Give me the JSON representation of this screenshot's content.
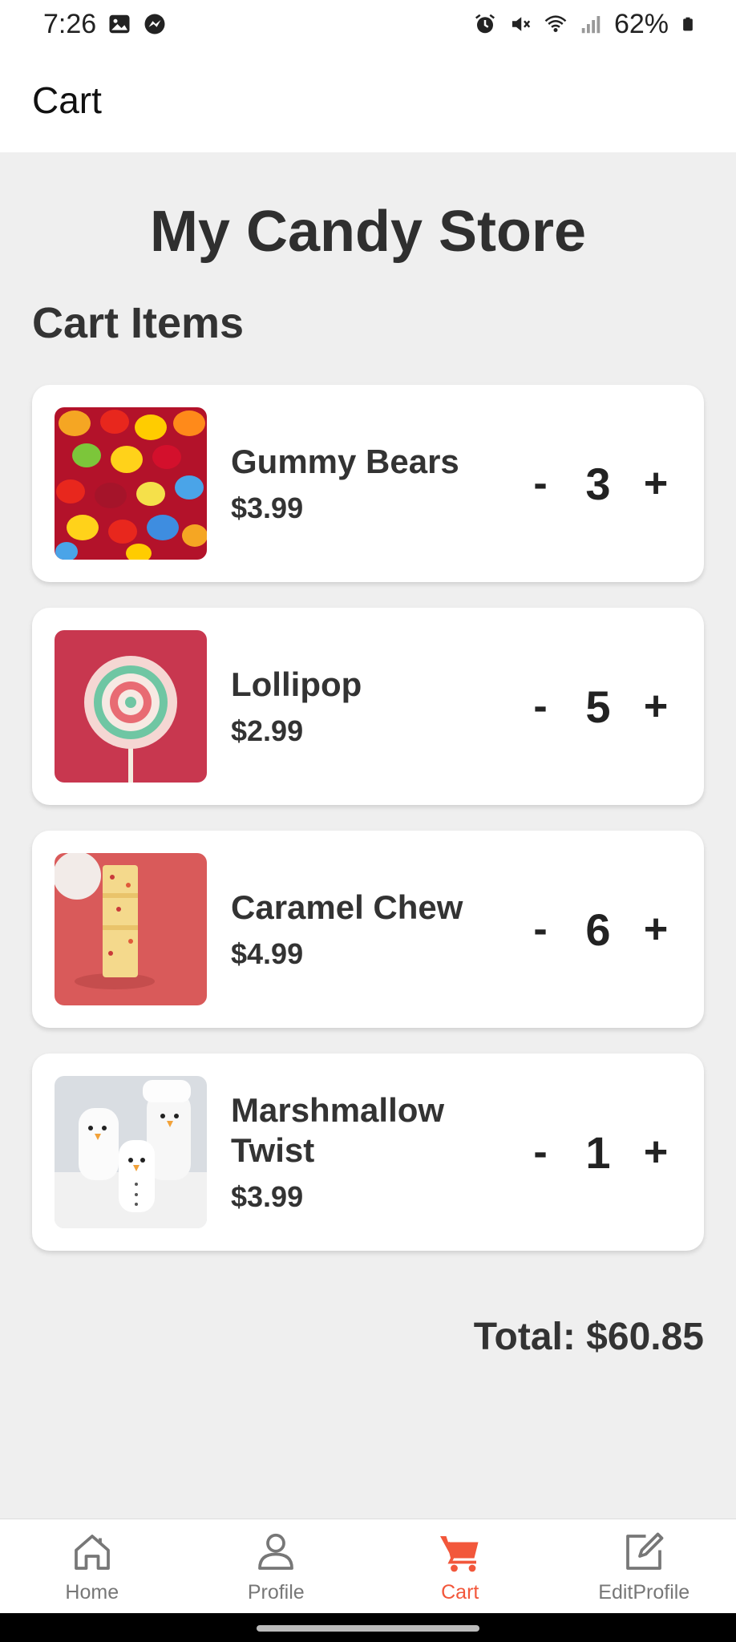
{
  "status_bar": {
    "time": "7:26",
    "battery": "62%"
  },
  "app_bar": {
    "title": "Cart"
  },
  "store": {
    "title": "My Candy Store"
  },
  "section": {
    "title": "Cart Items"
  },
  "cart_items": [
    {
      "name": "Gummy Bears",
      "price": "$3.99",
      "quantity": "3",
      "decrement": "-",
      "increment": "+"
    },
    {
      "name": "Lollipop",
      "price": "$2.99",
      "quantity": "5",
      "decrement": "-",
      "increment": "+"
    },
    {
      "name": "Caramel Chew",
      "price": "$4.99",
      "quantity": "6",
      "decrement": "-",
      "increment": "+"
    },
    {
      "name": "Marshmallow Twist",
      "price": "$3.99",
      "quantity": "1",
      "decrement": "-",
      "increment": "+"
    }
  ],
  "total": {
    "label": "Total: $60.85"
  },
  "bottom_nav": {
    "items": [
      {
        "label": "Home",
        "icon": "home-icon"
      },
      {
        "label": "Profile",
        "icon": "person-icon"
      },
      {
        "label": "Cart",
        "icon": "cart-icon",
        "active": true
      },
      {
        "label": "EditProfile",
        "icon": "edit-icon"
      }
    ]
  },
  "colors": {
    "accent": "#f2573b",
    "background": "#efefef"
  }
}
